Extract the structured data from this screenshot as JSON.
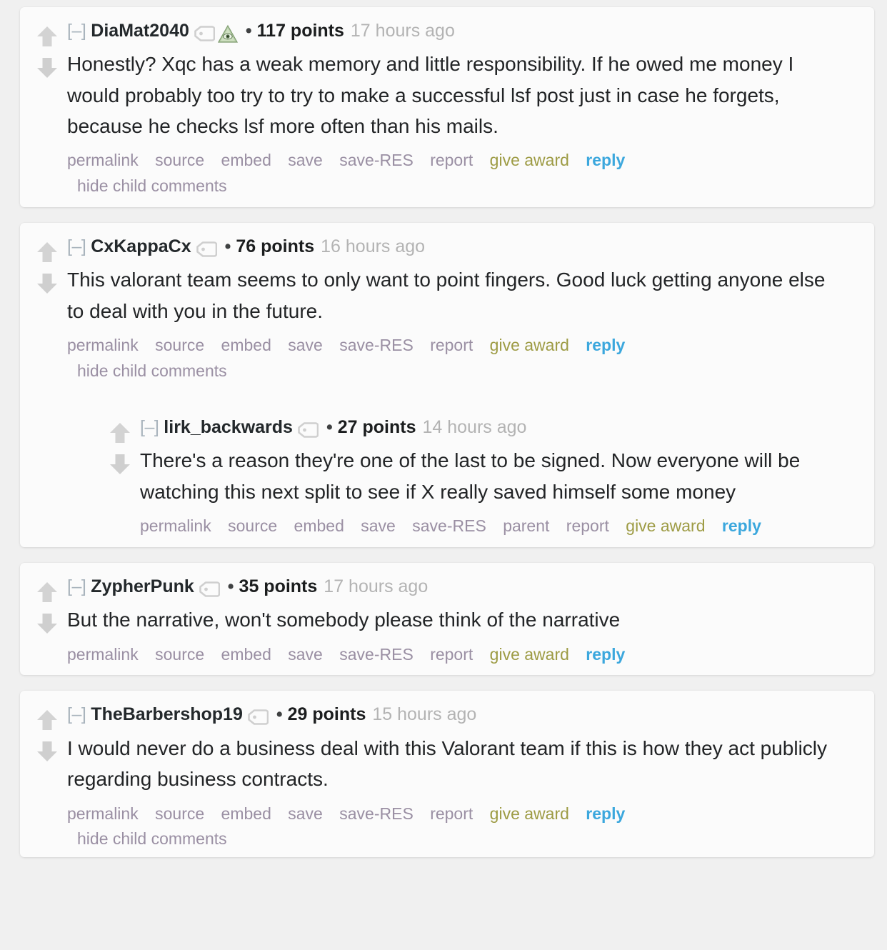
{
  "page": {
    "background_color": "#f0f0f0",
    "card_color": "#fbfbfb",
    "accent_reply_color": "#3ba7dd",
    "accent_award_color": "#9d9b44",
    "link_color": "#9a8fa3"
  },
  "icons": {
    "upvote": "upvote-arrow-icon",
    "downvote": "downvote-arrow-icon",
    "user_tag": "user-tag-icon",
    "flair_illuminati": "illuminati-pyramid-eye-emoji",
    "collapse": "[–]",
    "separator": "•"
  },
  "actions": {
    "permalink": "permalink",
    "source": "source",
    "embed": "embed",
    "save": "save",
    "save_res": "save-RES",
    "parent": "parent",
    "report": "report",
    "give_award": "give award",
    "reply": "reply",
    "hide_child_comments": "hide child comments"
  },
  "comments": [
    {
      "id": "c1",
      "collapse": "[–]",
      "author": "DiaMat2040",
      "has_user_tag": true,
      "flair": "illuminati-pyramid-eye-emoji",
      "separator": "•",
      "score": "117 points",
      "age": "17 hours ago",
      "body": "Honestly? Xqc has a weak memory and little responsibility. If he owed me money I would probably too try to try to make a successful lsf post just in case he forgets, because he checks lsf more often than his mails.",
      "has_parent_link": false,
      "has_hide_child": true
    },
    {
      "id": "c2",
      "collapse": "[–]",
      "author": "CxKappaCx",
      "has_user_tag": true,
      "flair": null,
      "separator": "•",
      "score": "76 points",
      "age": "16 hours ago",
      "body": "This valorant team seems to only want to point fingers. Good luck getting anyone else to deal with you in the future.",
      "has_parent_link": false,
      "has_hide_child": true,
      "reply": {
        "id": "c2r1",
        "collapse": "[–]",
        "author": "lirk_backwards",
        "has_user_tag": true,
        "flair": null,
        "separator": "•",
        "score": "27 points",
        "age": "14 hours ago",
        "body": "There's a reason they're one of the last to be signed. Now everyone will be watching this next split to see if X really saved himself some money",
        "has_parent_link": true,
        "has_hide_child": false
      }
    },
    {
      "id": "c3",
      "collapse": "[–]",
      "author": "ZypherPunk",
      "has_user_tag": true,
      "flair": null,
      "separator": "•",
      "score": "35 points",
      "age": "17 hours ago",
      "body": "But the narrative, won't somebody please think of the narrative",
      "has_parent_link": false,
      "has_hide_child": false
    },
    {
      "id": "c4",
      "collapse": "[–]",
      "author": "TheBarbershop19",
      "has_user_tag": true,
      "flair": null,
      "separator": "•",
      "score": "29 points",
      "age": "15 hours ago",
      "body": "I would never do a business deal with this Valorant team if this is how they act publicly regarding business contracts.",
      "has_parent_link": false,
      "has_hide_child": true
    }
  ]
}
